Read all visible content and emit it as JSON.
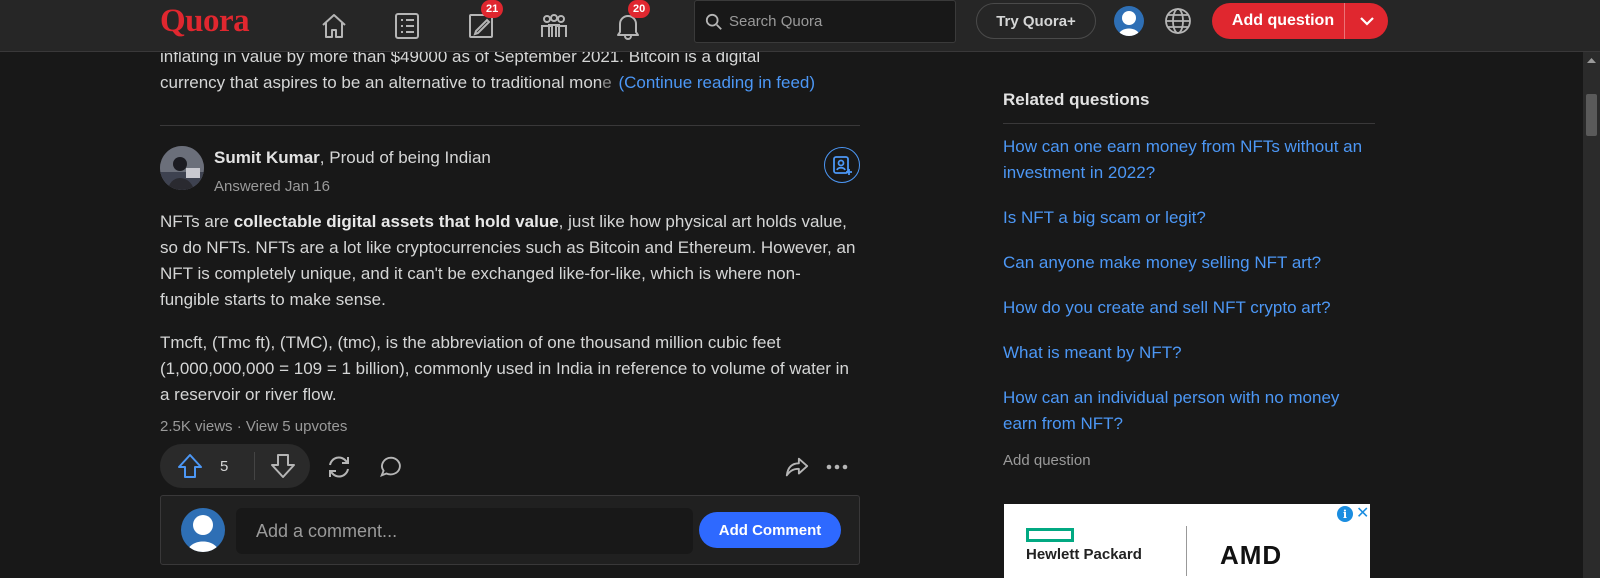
{
  "header": {
    "logo": "Quora",
    "notifications": {
      "answer_badge": "21",
      "bell_badge": "20"
    },
    "search": {
      "placeholder": "Search Quora"
    },
    "try_plus_label": "Try Quora+",
    "add_question_label": "Add question",
    "accent_color": "#e0272f"
  },
  "feed": {
    "previous_answer": {
      "line1": "inflating in value by more than $49000 as of September 2021. Bitcoin is a digital",
      "line2_start": "currency that aspires to be an alternative to traditional mon",
      "line2_fade": "e",
      "continue_link": "(Continue reading in feed)"
    },
    "answer": {
      "author_name": "Sumit Kumar",
      "author_credential": ", Proud of being Indian",
      "answered": "Answered Jan 16",
      "para1_a": "NFTs are ",
      "para1_bold": "collectable digital assets that hold value",
      "para1_b": ", just like how physical art holds value, so do NFTs. NFTs are a lot like cryptocurrencies such as Bitcoin and Ethereum. However, an NFT is completely unique, and it can't be exchanged like-for-like, which is where non-fungible starts to make sense.",
      "para2": "Tmcft, (Tmc ft), (TMC), (tmc), is the abbreviation of one thousand million cubic feet (1,000,000,000 = 109 = 1 billion), commonly used in India in reference to volume of water in a reservoir or river flow.",
      "stats": "2.5K views · View 5 upvotes",
      "upvote_count": "5"
    },
    "comment": {
      "placeholder": "Add a comment...",
      "button_label": "Add Comment"
    }
  },
  "sidebar": {
    "related_title": "Related questions",
    "related": [
      "How can one earn money from NFTs without an investment in 2022?",
      "Is NFT a big scam or legit?",
      "Can anyone make money selling NFT art?",
      "How do you create and sell NFT crypto art?",
      "What is meant by NFT?",
      "How can an individual person with no money earn from NFT?"
    ],
    "add_question": "Add question",
    "ad": {
      "brand1": "Hewlett Packard",
      "brand2": "AMD"
    }
  }
}
